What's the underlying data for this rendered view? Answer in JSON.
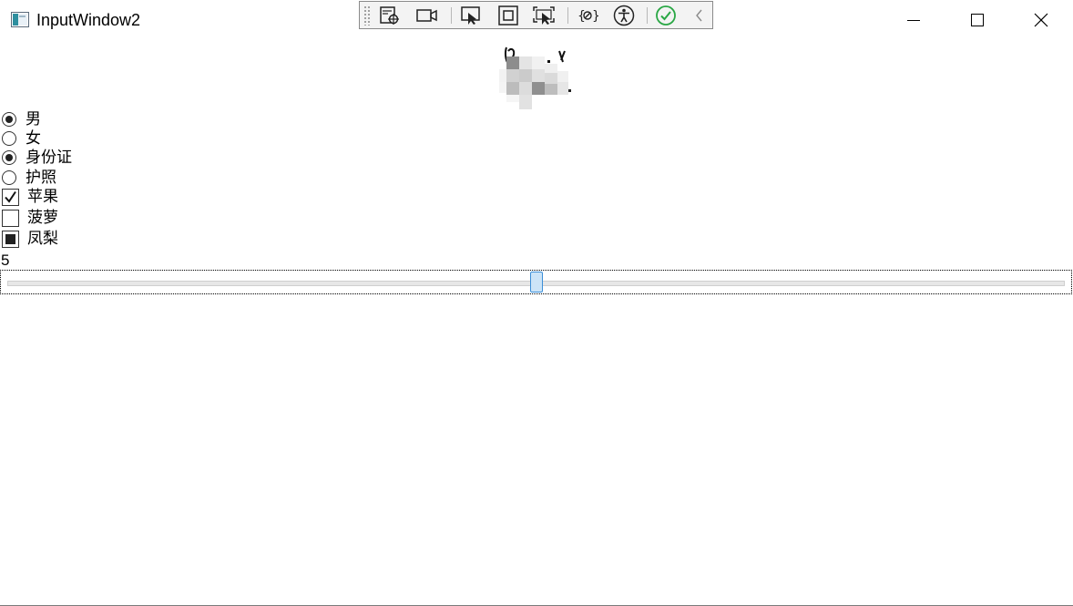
{
  "window": {
    "title": "InputWindow2",
    "controls": {
      "minimize": "minimize-icon",
      "maximize": "maximize-icon",
      "close": "close-icon"
    }
  },
  "debug_toolbar": {
    "icons": [
      "select-element-icon",
      "video-record-icon",
      "pointer-select-icon",
      "layout-adorner-icon",
      "track-focus-icon",
      "binding-failures-icon",
      "accessibility-icon",
      "checkmark-icon",
      "collapse-chevron-icon"
    ]
  },
  "gender": {
    "options": [
      {
        "label": "男",
        "checked": true
      },
      {
        "label": "女",
        "checked": false
      }
    ]
  },
  "id_type": {
    "options": [
      {
        "label": "身份证",
        "checked": true
      },
      {
        "label": "护照",
        "checked": false
      }
    ]
  },
  "fruits": {
    "options": [
      {
        "label": "苹果",
        "state": "checked"
      },
      {
        "label": "菠萝",
        "state": "unchecked"
      },
      {
        "label": "凤梨",
        "state": "indeterminate"
      }
    ]
  },
  "slider": {
    "value_text": "5",
    "value": 5,
    "min": 0,
    "max": 10
  },
  "colors": {
    "thumb_fill": "#cce4f7",
    "thumb_border": "#3d8fd8",
    "check_ok": "#2aa745"
  }
}
